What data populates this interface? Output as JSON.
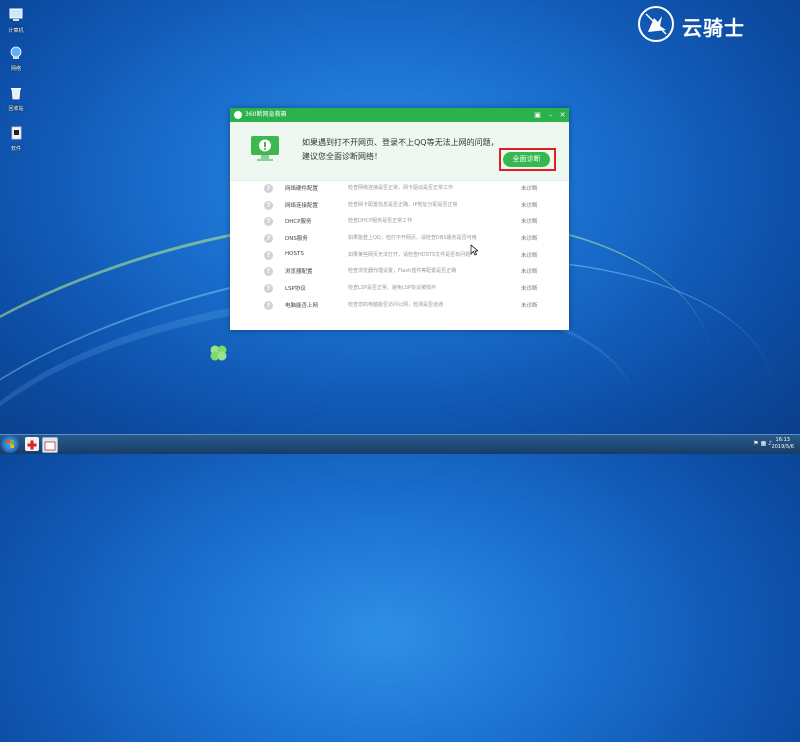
{
  "desktop": {
    "icons": [
      {
        "label": "计算机",
        "icon": "computer-icon"
      },
      {
        "label": "网络",
        "icon": "network-icon"
      },
      {
        "label": "回收站",
        "icon": "recycle-bin-icon"
      },
      {
        "label": "软件",
        "icon": "software-icon"
      }
    ],
    "watermark": "云骑士"
  },
  "window": {
    "title": "360断网急救箱",
    "message_line1": "如果遇到打不开网页、登录不上QQ等无法上网的问题，",
    "message_line2": "建议您全面诊断网络！",
    "full_check_button": "全面诊断",
    "items": [
      {
        "name": "网络硬件配置",
        "desc": "检查网络连接是否正常，网卡驱动是否正常工作",
        "status": "未诊断"
      },
      {
        "name": "网络连接配置",
        "desc": "检查网卡配置信息是否正确，IP地址分配是否正常",
        "status": "未诊断"
      },
      {
        "name": "DHCP服务",
        "desc": "检查DHCP服务是否正常工作",
        "status": "未诊断"
      },
      {
        "name": "DNS服务",
        "desc": "如果能登上QQ，但打不开网页，请检查DNS服务是否可用",
        "status": "未诊断"
      },
      {
        "name": "HOSTS",
        "desc": "如果某些网页无法打开，请检查HOSTS文件是否有问题",
        "status": "未诊断"
      },
      {
        "name": "浏览器配置",
        "desc": "检查浏览器代理设置，Flash插件等配置是否正确",
        "status": "未诊断"
      },
      {
        "name": "LSP协议",
        "desc": "检查LSP是否正常，避免LSP协议被损坏",
        "status": "未诊断"
      },
      {
        "name": "电脑能否上网",
        "desc": "检查您的电脑能否访问公网，检测是否连通",
        "status": "未诊断"
      }
    ]
  },
  "taskbar": {
    "time": "16:13",
    "date": "2019/5/6"
  },
  "colors": {
    "accent": "#2bb24c",
    "highlight": "#e02020"
  }
}
